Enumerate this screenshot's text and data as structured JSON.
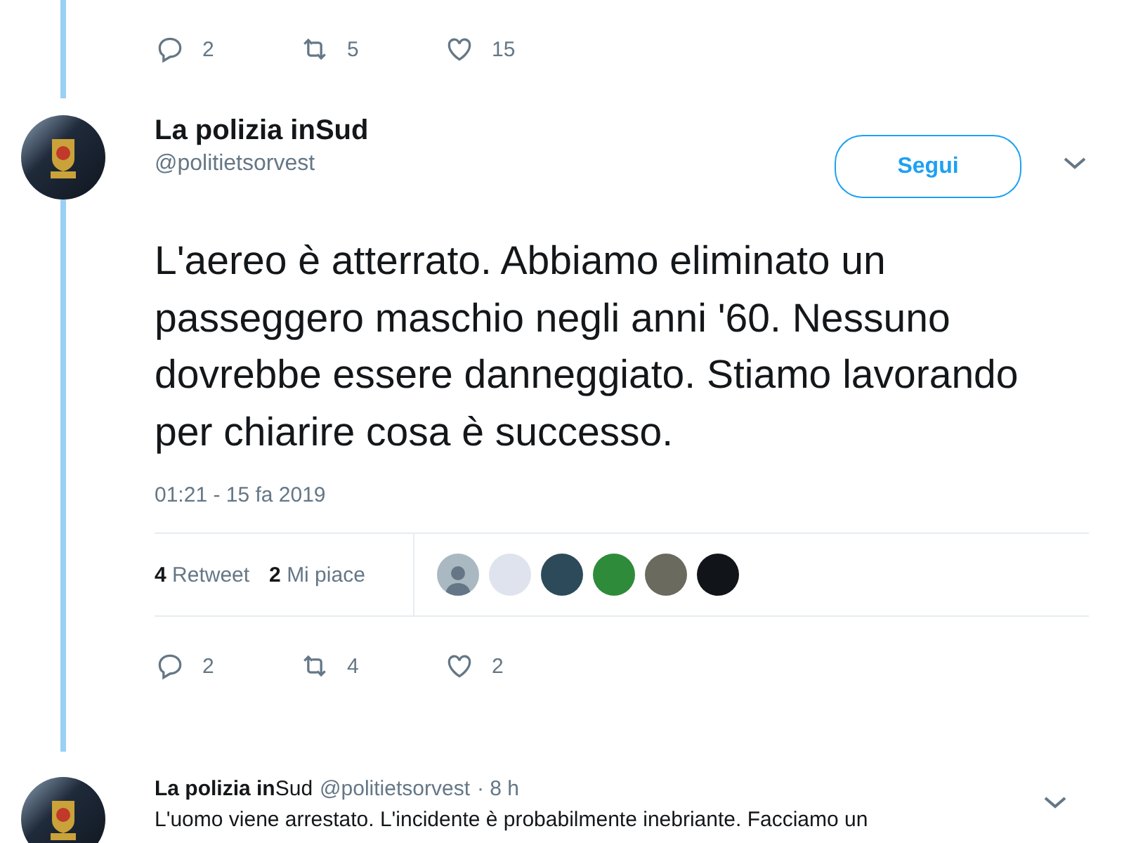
{
  "previous_tweet": {
    "actions": [
      {
        "kind": "reply",
        "count": "2"
      },
      {
        "kind": "retweet",
        "count": "5"
      },
      {
        "kind": "like",
        "count": "15"
      }
    ]
  },
  "tweet": {
    "name": "La polizia inSud",
    "handle": "@politietsorvest",
    "follow_button": "Segui",
    "text": "L'aereo è atterrato. Abbiamo eliminato un passeggero maschio negli anni '60. Nessuno dovrebbe essere danneggiato. Stiamo lavorando per chiarire cosa è successo.",
    "timestamp": "01:21 - 15 fa 2019",
    "stats": [
      {
        "count": "4",
        "label": "Retweet"
      },
      {
        "count": "2",
        "label": "Mi piace"
      }
    ],
    "likers": [
      {
        "kind": "silhouette",
        "color": "#aab8c2"
      },
      {
        "kind": "photo",
        "color": "#dfe3ee"
      },
      {
        "kind": "photo",
        "color": "#2d4a5a"
      },
      {
        "kind": "photo",
        "color": "#2e8b3a"
      },
      {
        "kind": "photo",
        "color": "#6b6a5e"
      },
      {
        "kind": "photo",
        "color": "#111418"
      }
    ],
    "actions": [
      {
        "kind": "reply",
        "count": "2"
      },
      {
        "kind": "retweet",
        "count": "4"
      },
      {
        "kind": "like",
        "count": "2"
      }
    ]
  },
  "reply": {
    "name": "**La polizia in**Sud",
    "handle": "@politietsorvest",
    "time": "· 8 h",
    "text": "L'uomo viene arrestato. L'incidente è probabilmente inebriante. Facciamo un"
  }
}
